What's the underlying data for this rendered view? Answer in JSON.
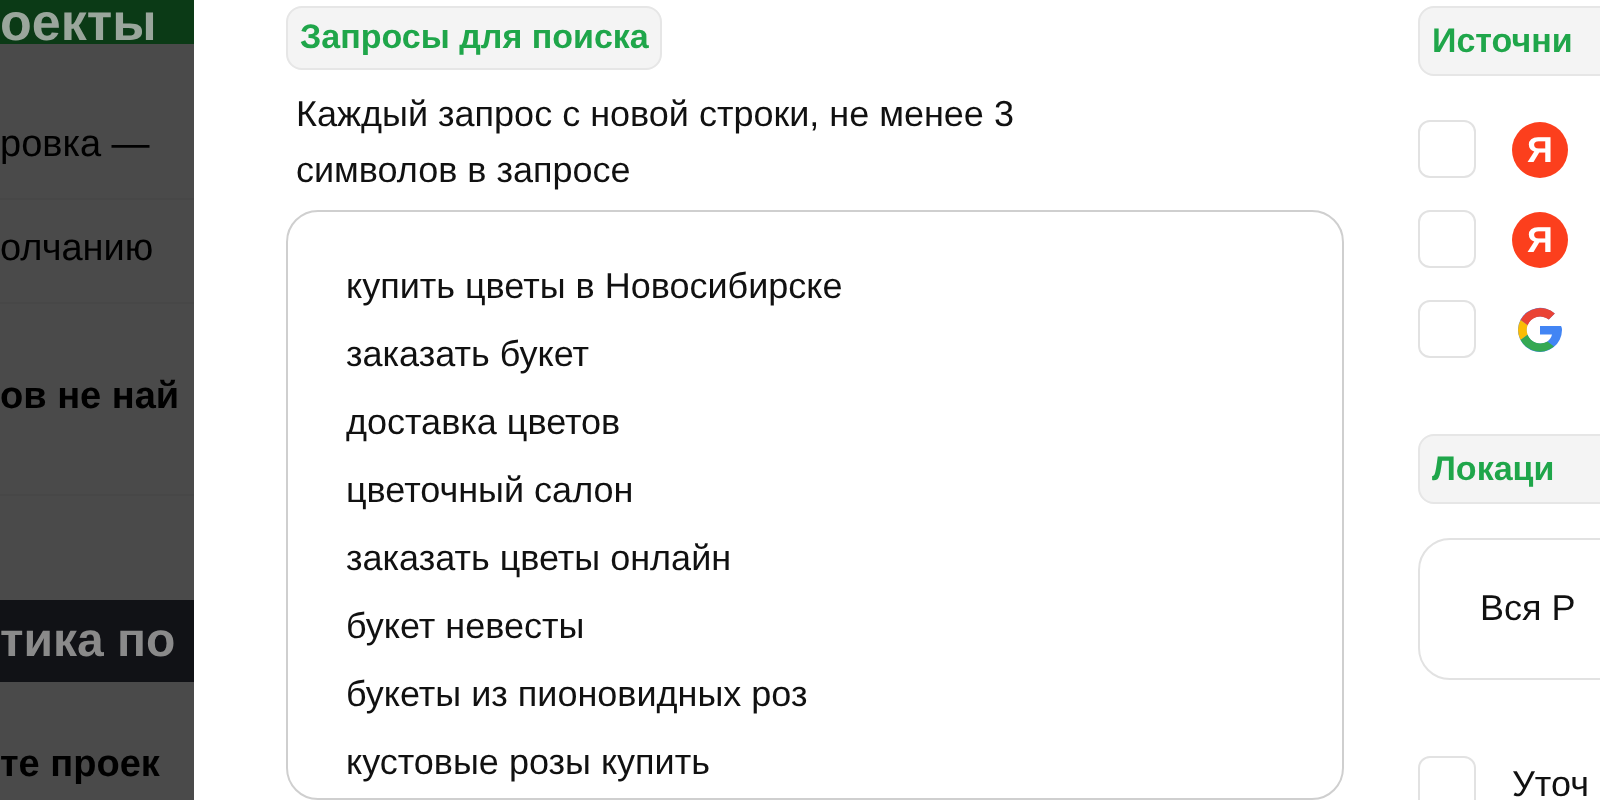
{
  "background_page": {
    "header": "оекты",
    "rows": [
      {
        "text": "ровка —",
        "bold": false
      },
      {
        "text": "олчанию",
        "bold": false
      },
      {
        "text": "ов не най",
        "bold": true
      }
    ],
    "section_bar": "тика по",
    "footer_text": "те проек"
  },
  "queries": {
    "label": "Запросы для поиска",
    "hint": "Каждый запрос с новой строки, не менее 3 символов в запросе",
    "lines": [
      "купить цветы в Новосибирске",
      "заказать букет",
      "доставка цветов",
      "цветочный салон",
      "заказать цветы онлайн",
      "букет невесты",
      "букеты из пионовидных роз",
      "кустовые розы купить"
    ]
  },
  "sources": {
    "label": "Источни",
    "items": [
      {
        "kind": "yandex",
        "letter": "Я",
        "checked": false
      },
      {
        "kind": "yandex",
        "letter": "Я",
        "checked": false
      },
      {
        "kind": "google",
        "checked": false
      }
    ]
  },
  "location": {
    "label": "Локаци",
    "value": "Вся Р"
  },
  "refine": {
    "label": "Уточ",
    "checked": false
  }
}
